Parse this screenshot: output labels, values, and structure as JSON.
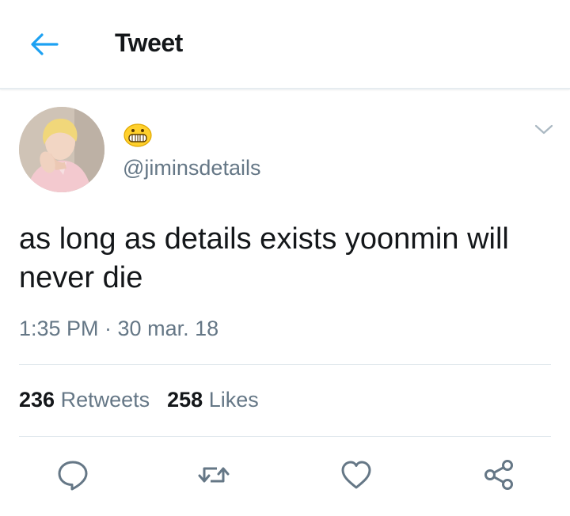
{
  "header": {
    "title": "Tweet",
    "back_icon": "arrow-left-icon",
    "accent_color": "#1da1f2"
  },
  "tweet": {
    "display_name_icon": "grinning-face-emoji",
    "handle": "@jiminsdetails",
    "text": "as long as details exists yoonmin will never die",
    "timestamp": "1:35 PM · 30 mar. 18",
    "retweets": {
      "count": "236",
      "label": "Retweets"
    },
    "likes": {
      "count": "258",
      "label": "Likes"
    }
  },
  "actions": [
    {
      "name": "reply",
      "icon": "speech-bubble-icon"
    },
    {
      "name": "retweet",
      "icon": "retweet-arrows-icon"
    },
    {
      "name": "like",
      "icon": "heart-icon"
    },
    {
      "name": "share",
      "icon": "share-nodes-icon"
    }
  ]
}
